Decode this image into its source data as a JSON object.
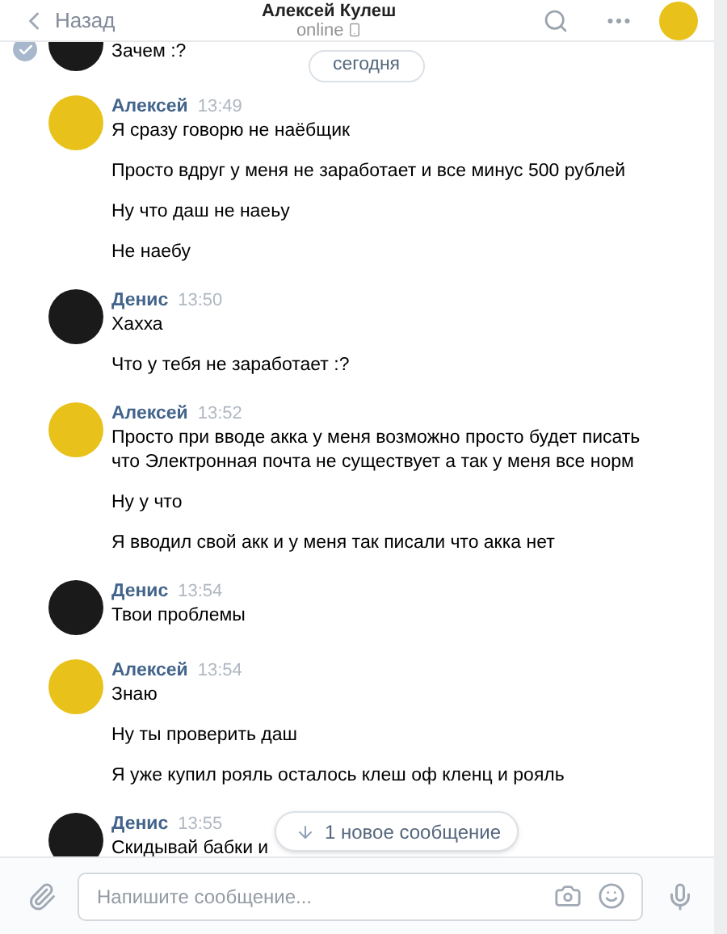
{
  "header": {
    "back": "Назад",
    "title": "Алексей Кулеш",
    "status": "online"
  },
  "date_pill": "сегодня",
  "groups": [
    {
      "color": "#1a1a1a",
      "selected": true,
      "messages": [
        "Зачем :?"
      ]
    },
    {
      "color": "#e8c21a",
      "selected": false,
      "author": "Алексей",
      "time": "13:49",
      "messages": [
        "Я сразу говорю не наёбщик",
        "Просто вдруг у меня не заработает и все минус 500 рублей",
        "Ну что даш не наеьу",
        "Не наебу"
      ]
    },
    {
      "color": "#1a1a1a",
      "selected": false,
      "author": "Денис",
      "time": "13:50",
      "messages": [
        "Хахха",
        "Что у тебя не заработает :?"
      ]
    },
    {
      "color": "#e8c21a",
      "selected": false,
      "author": "Алексей",
      "time": "13:52",
      "messages": [
        "Просто при вводе акка у меня возможно просто будет писать что Электронная почта не существует а так у меня все норм",
        "Ну у что",
        "Я вводил свой акк и у меня так писали что акка нет"
      ]
    },
    {
      "color": "#1a1a1a",
      "selected": false,
      "author": "Денис",
      "time": "13:54",
      "messages": [
        "Твои проблемы"
      ]
    },
    {
      "color": "#e8c21a",
      "selected": false,
      "author": "Алексей",
      "time": "13:54",
      "messages": [
        "Знаю",
        "Ну ты проверить даш",
        "Я уже купил рояль осталось клеш оф кленц и рояль"
      ]
    },
    {
      "color": "#1a1a1a",
      "selected": false,
      "author": "Денис",
      "time": "13:55",
      "messages": [
        "Скидывай бабки и"
      ]
    }
  ],
  "new_messages": "1 новое сообщение",
  "composer": {
    "placeholder": "Напишите сообщение..."
  }
}
